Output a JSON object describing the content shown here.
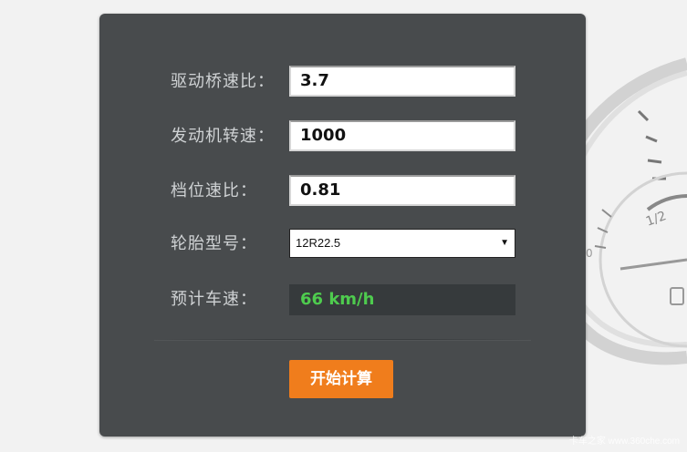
{
  "form": {
    "axle_ratio_label": "驱动桥速比：",
    "axle_ratio_value": "3.7",
    "engine_speed_label": "发动机转速：",
    "engine_speed_value": "1000",
    "gear_ratio_label": "档位速比：",
    "gear_ratio_value": "0.81",
    "tire_model_label": "轮胎型号：",
    "tire_model_value": "12R22.5",
    "estimated_speed_label": "预计车速：",
    "estimated_speed_value": "66 km/h",
    "calculate_button_label": "开始计算"
  },
  "gauge_background": {
    "fuel_mark_label": "1/2",
    "empty_mark_label": "0"
  },
  "watermark": "卡车之家 www.360che.com",
  "colors": {
    "panel_bg": "#484b4d",
    "accent_button": "#f07d1c",
    "result_text": "#4ecb4e"
  }
}
